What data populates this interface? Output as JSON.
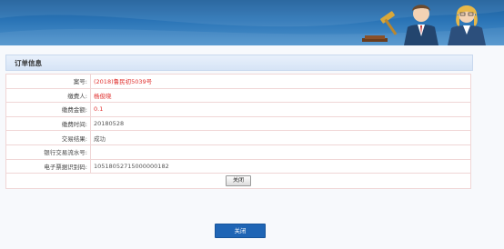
{
  "section": {
    "title": "订单信息"
  },
  "rows": [
    {
      "label": "案号:",
      "value": "(2018)鲁民初5039号",
      "highlight": true
    },
    {
      "label": "缴费人:",
      "value": "杨俊晓",
      "highlight": true
    },
    {
      "label": "缴费金额:",
      "value": "0.1",
      "highlight": true
    },
    {
      "label": "缴费时间:",
      "value": "20180528",
      "highlight": false
    },
    {
      "label": "交易结果:",
      "value": "成功",
      "highlight": false
    },
    {
      "label": "银行交易流水号:",
      "value": "",
      "highlight": false
    },
    {
      "label": "电子票据识别码:",
      "value": "10518052715000000182",
      "highlight": false
    }
  ],
  "buttons": {
    "inline_close": "关闭",
    "main_close": "关闭"
  },
  "colors": {
    "highlight": "#e0312f",
    "primary_button": "#1f65b5",
    "banner": "#2a74b6"
  }
}
